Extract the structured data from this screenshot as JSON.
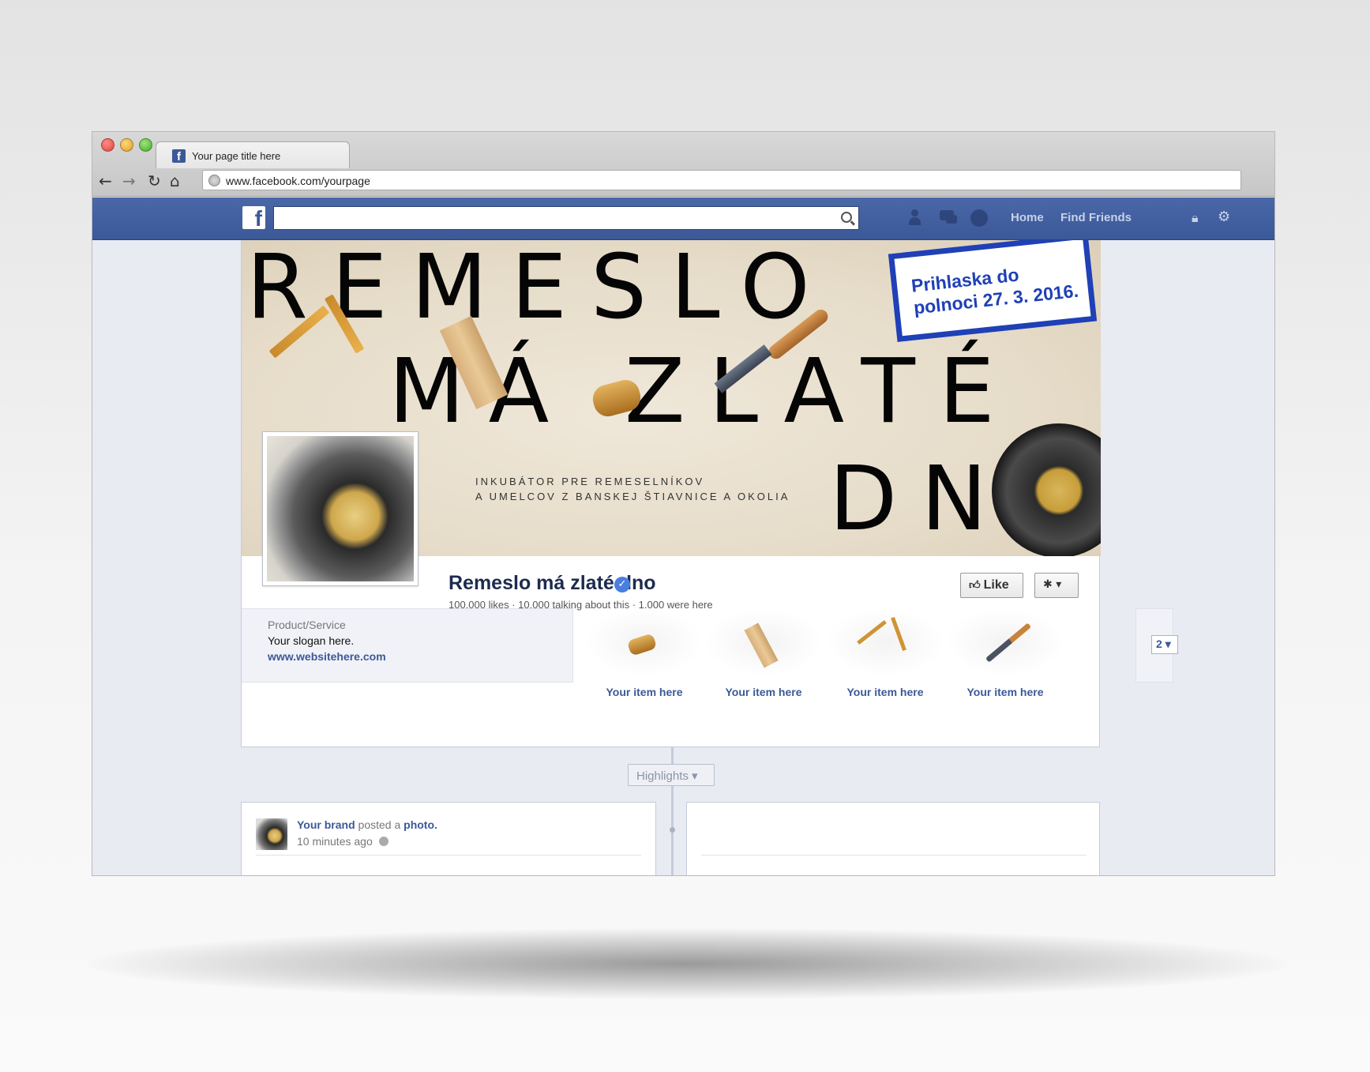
{
  "browser": {
    "tab_title": "Your page title here",
    "url": "www.facebook.com/yourpage",
    "back_icon": "arrow-left-icon",
    "forward_icon": "arrow-right-icon",
    "reload_icon": "reload-icon",
    "home_icon": "home-icon"
  },
  "facebook": {
    "logo_letter": "f",
    "search_placeholder": "",
    "nav_home": "Home",
    "nav_find_friends": "Find Friends"
  },
  "cover": {
    "line1": "REMESLO",
    "line2": "MÁ ZLATÉ",
    "line3": "DN",
    "subtitle_line1": "INKUBÁTOR PRE REMESELNÍKOV",
    "subtitle_line2": "A UMELCOV Z BANSKEJ ŠTIAVNICE A OKOLIA",
    "stamp_line1": "Prihlaska do",
    "stamp_line2": "polnoci 27. 3. 2016.",
    "stamp_color": "#1f40b6"
  },
  "page": {
    "name": "Remeslo má zlaté dno",
    "stats": "100,000 likes · 10,000 talking about this · 1,000 were here",
    "like_label": "Like",
    "settings_arrow": "▾"
  },
  "about": {
    "category": "Product/Service",
    "slogan": "Your slogan here.",
    "website": "www.websitehere.com"
  },
  "apps": [
    {
      "label": "Your item here",
      "icon": "thread-spool-icon"
    },
    {
      "label": "Your item here",
      "icon": "wood-plank-icon"
    },
    {
      "label": "Your item here",
      "icon": "folding-ruler-icon"
    },
    {
      "label": "Your item here",
      "icon": "chisel-icon"
    }
  ],
  "apps_more_count": "2",
  "timeline": {
    "highlights_label": "Highlights"
  },
  "post": {
    "author": "Your brand",
    "action": "posted a",
    "object": "photo.",
    "time": "10 minutes ago"
  },
  "colors": {
    "facebook_blue": "#3b5998",
    "link_blue": "#3b5998"
  }
}
